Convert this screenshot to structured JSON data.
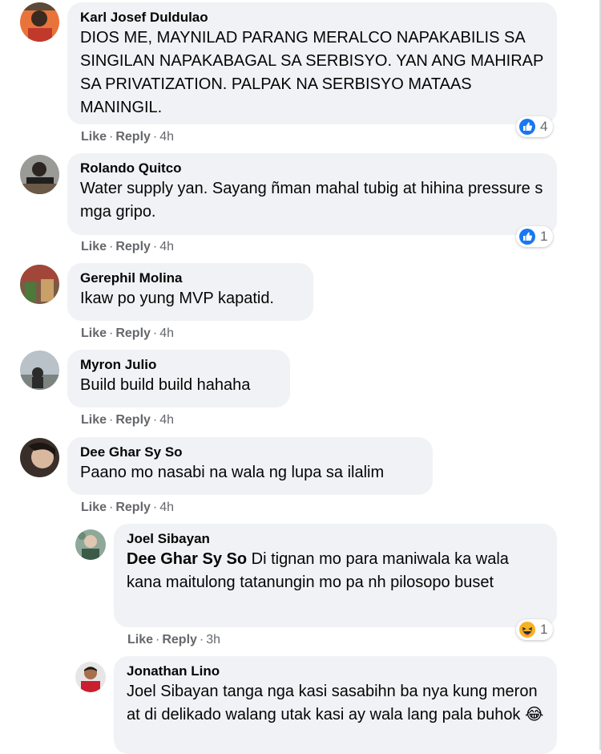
{
  "comments": [
    {
      "author": "Karl Josef Duldulao",
      "text": "DIOS ME, MAYNILAD PARANG MERALCO NAPAKABILIS SA SINGILAN NAPAKABAGAL SA SERBISYO. YAN ANG MAHIRAP SA PRIVATIZATION. PALPAK NA SERBISYO MATAAS MANINGIL.",
      "like": "Like",
      "reply": "Reply",
      "time": "4h",
      "reaction": {
        "icon": "like-reaction-icon",
        "count": "4"
      }
    },
    {
      "author": "Rolando Quitco",
      "text": "Water supply yan. Sayang ñman mahal tubig at hihina pressure s mga gripo.",
      "like": "Like",
      "reply": "Reply",
      "time": "4h",
      "reaction": {
        "icon": "like-reaction-icon",
        "count": "1"
      }
    },
    {
      "author": "Gerephil Molina",
      "text": "Ikaw po yung MVP kapatid.",
      "like": "Like",
      "reply": "Reply",
      "time": "4h"
    },
    {
      "author": "Myron Julio",
      "text": "Build build build hahaha",
      "like": "Like",
      "reply": "Reply",
      "time": "4h"
    },
    {
      "author": "Dee Ghar Sy So",
      "text": "Paano mo nasabi na wala ng lupa sa ilalim",
      "like": "Like",
      "reply": "Reply",
      "time": "4h"
    }
  ],
  "replies": [
    {
      "author": "Joel Sibayan",
      "mention": "Dee Ghar Sy So",
      "text": " Di tignan mo para maniwala ka wala kana maitulong tatanungin mo pa nh pilosopo buset",
      "like": "Like",
      "reply": "Reply",
      "time": "3h",
      "reaction": {
        "icon": "haha-reaction-icon",
        "count": "1"
      }
    },
    {
      "author": "Jonathan Lino",
      "text": "Joel Sibayan tanga nga kasi sasabihn ba nya kung meron at di delikado walang utak kasi ay wala lang pala buhok",
      "emoji": "😂"
    }
  ],
  "separator": "·",
  "colors": {
    "bubble": "#f0f2f5",
    "secondary_text": "#65676b",
    "like_blue": "#1877f2",
    "haha_yellow": "#f7b125"
  }
}
